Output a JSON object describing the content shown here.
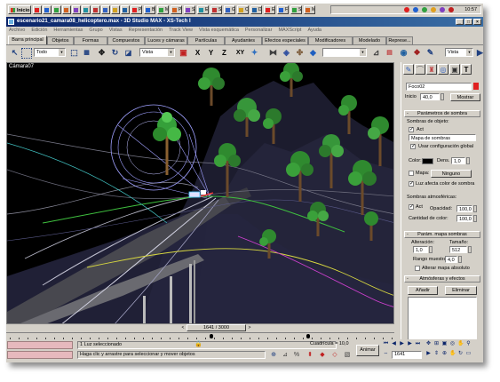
{
  "taskbar": {
    "start_label": "Inicio",
    "buttons": [
      "",
      "",
      "",
      "",
      "",
      "",
      "",
      "",
      "",
      "",
      "Pr...",
      "B...",
      "M...",
      "P...",
      "S...",
      "E...",
      "S...",
      "G...",
      "C...",
      "D...",
      "E...",
      "F...",
      "S...",
      "M..."
    ],
    "clock": "10:57"
  },
  "titlebar": {
    "title": "escenario21_camara08_helicoptero.max - 3D Studio MAX - XS-Tech I",
    "min": "_",
    "max": "□",
    "close": "×"
  },
  "menubar": {
    "items": [
      "Archivo",
      "Edición",
      "Herramientas",
      "Grupo",
      "Vistas",
      "Representación",
      "Track View",
      "Vista esquemática",
      "Personalizar",
      "MAXScript",
      "Ayuda"
    ]
  },
  "tabs": {
    "items": [
      "Barra principal",
      "Objetos",
      "Formas",
      "Compuestos",
      "Luces y cámaras",
      "Partículas",
      "Ayudantes",
      "Efectos especiales",
      "Modificadores",
      "Modelado",
      "Represe..."
    ]
  },
  "toolbar": {
    "selection_filter": "Todo",
    "ref_coord": "Vista",
    "named_selection": "",
    "ref_coord_right": "Vista",
    "axis_x": "X",
    "axis_y": "Y",
    "axis_z": "Z",
    "axis_xy": "XY"
  },
  "viewport": {
    "label": "Cámara07"
  },
  "cmdpanel": {
    "object_name": "Foco02",
    "start_label": "Inicio",
    "start_value": "40,0",
    "show_button": "Mostrar",
    "rollout_shadow_params": "Parámetros de sombra",
    "object_shadows_label": "Sombras de objeto:",
    "act_label": "Act",
    "shadow_type": "Mapa de sombras",
    "use_global_label": "Usar configuración global",
    "color_label": "Color:",
    "dens_label": "Dens.",
    "dens_value": "1,0",
    "map_label": "Mapa:",
    "map_button": "Ninguno",
    "light_affects_label": "Luz afecta color de sombra",
    "atmos_shadows_label": "Sombras atmosféricas:",
    "atmos_act_label": "Act",
    "opacity_label": "Opacidad:",
    "opacity_value": "100,0",
    "color_amount_label": "Cantidad de color:",
    "color_amount_value": "100,0",
    "rollout_shadow_map": "Parám. mapa sombras",
    "bias_label": "Alteración:",
    "bias_value": "1,0",
    "size_label": "Tamaño:",
    "size_value": "512",
    "sample_range_label": "Rango muestra:",
    "sample_range_value": "4,0",
    "absolute_bias_label": "Alterar mapa absoluto",
    "rollout_atmos": "Atmósferas y efectos",
    "add_button": "Añadir",
    "delete_button": "Eliminar",
    "minus": "-",
    "plus": "+"
  },
  "timeslider": {
    "frame_text": "1641 / 3000"
  },
  "status": {
    "selection_text": "1 Luz seleccionado",
    "prompt_text": "Haga clic y arrastre para seleccionar y mover objetos",
    "grid_text": "Cuadrícula = 10,0",
    "animate_button": "Animar",
    "current_frame": "1641"
  },
  "colors": {
    "titlebar_start": "#0a246a",
    "titlebar_end": "#3a6ea5",
    "panel_bg": "#d4d0c8",
    "light_swatch": "#e02020",
    "status_pink": "#e6b9bd"
  }
}
